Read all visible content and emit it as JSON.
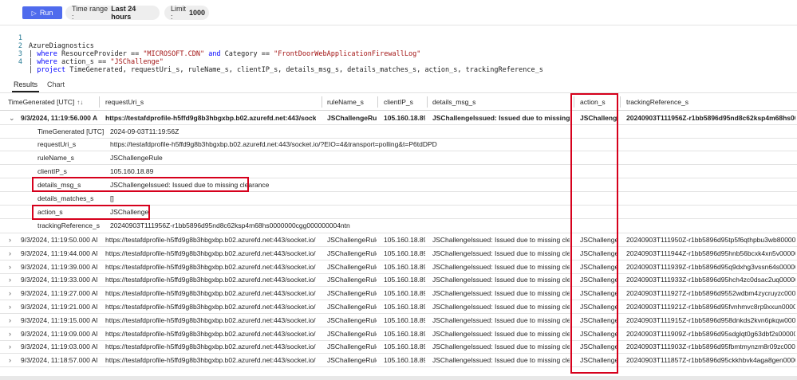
{
  "toolbar": {
    "run_label": "Run",
    "time_range_label": "Time range :",
    "time_range_value": "Last 24 hours",
    "limit_label": "Limit :",
    "limit_value": "1000"
  },
  "editor": {
    "lines": [
      {
        "num": "1",
        "text": "AzureDiagnostics"
      },
      {
        "num": "2",
        "pipe": "| ",
        "kw1": "where",
        "t1": " ResourceProvider == ",
        "s1": "\"MICROSOFT.CDN\"",
        "kw2": " and",
        "t2": " Category == ",
        "s2": "\"FrontDoorWebApplicationFirewallLog\""
      },
      {
        "num": "3",
        "pipe": "| ",
        "kw1": "where",
        "t1": " action_s == ",
        "s1": "\"JSChallenge\""
      },
      {
        "num": "4",
        "pipe": "| ",
        "kw1": "project",
        "t1": " TimeGenerated, requestUri_s, ruleName_s, clientIP_s, details_msg_s, details_matches_s, action_s, trackingReference_s"
      }
    ],
    "more": "···"
  },
  "tabs": [
    "Results",
    "Chart"
  ],
  "columns": [
    "TimeGenerated [UTC]",
    "requestUri_s",
    "ruleName_s",
    "clientIP_s",
    "details_msg_s",
    "action_s",
    "trackingReference_s"
  ],
  "expanded_row": {
    "time": "9/3/2024, 11:19:56.000 AM",
    "uri": "https://testafdprofile-h5ffd9g8b3hbgxbp.b02.azurefd.net:443/socket.io/?EI...",
    "rule": "JSChallengeRule",
    "ip": "105.160.18.89",
    "msg": "JSChallengeIssued: Issued due to missing cleara...",
    "action": "JSChallenge",
    "tracking": "20240903T111956Z-r1bb5896d95nd8c62ksp4m68hs000000..."
  },
  "details": [
    {
      "key": "TimeGenerated [UTC]",
      "value": "2024-09-03T11:19:56Z"
    },
    {
      "key": "requestUri_s",
      "value": "https://testafdprofile-h5ffd9g8b3hbgxbp.b02.azurefd.net:443/socket.io/?EIO=4&transport=polling&t=P6tdDPD"
    },
    {
      "key": "ruleName_s",
      "value": "JSChallengeRule"
    },
    {
      "key": "clientIP_s",
      "value": "105.160.18.89"
    },
    {
      "key": "details_msg_s",
      "value": "JSChallengeIssued: Issued due to missing clearance"
    },
    {
      "key": "details_matches_s",
      "value": "[]"
    },
    {
      "key": "action_s",
      "value": "JSChallenge"
    },
    {
      "key": "trackingReference_s",
      "value": "20240903T111956Z-r1bb5896d95nd8c62ksp4m68hs0000000cgg000000004ntn"
    }
  ],
  "rows": [
    {
      "time": "9/3/2024, 11:19:50.000 AM",
      "uri": "https://testafdprofile-h5ffd9g8b3hbgxbp.b02.azurefd.net:443/socket.io/?EIO=...",
      "rule": "JSChallengeRule",
      "ip": "105.160.18.89",
      "msg": "JSChallengeIssued: Issued due to missing clearance",
      "action": "JSChallenge",
      "tracking": "20240903T111950Z-r1bb5896d95tp5f6qthpbu3wb8000000..."
    },
    {
      "time": "9/3/2024, 11:19:44.000 AM",
      "uri": "https://testafdprofile-h5ffd9g8b3hbgxbp.b02.azurefd.net:443/socket.io/?EIO=...",
      "rule": "JSChallengeRule",
      "ip": "105.160.18.89",
      "msg": "JSChallengeIssued: Issued due to missing clearance",
      "action": "JSChallenge",
      "tracking": "20240903T111944Z-r1bb5896d95hnb56bcxk4xn5v000000..."
    },
    {
      "time": "9/3/2024, 11:19:39.000 AM",
      "uri": "https://testafdprofile-h5ffd9g8b3hbgxbp.b02.azurefd.net:443/socket.io/?EIO=...",
      "rule": "JSChallengeRule",
      "ip": "105.160.18.89",
      "msg": "JSChallengeIssued: Issued due to missing clearance",
      "action": "JSChallenge",
      "tracking": "20240903T111939Z-r1bb5896d95q9dxhg3vssn64s000000..."
    },
    {
      "time": "9/3/2024, 11:19:33.000 AM",
      "uri": "https://testafdprofile-h5ffd9g8b3hbgxbp.b02.azurefd.net:443/socket.io/?EIO=...",
      "rule": "JSChallengeRule",
      "ip": "105.160.18.89",
      "msg": "JSChallengeIssued: Issued due to missing clearance",
      "action": "JSChallenge",
      "tracking": "20240903T111933Z-r1bb5896d95hch4zc0dsac2uq000000..."
    },
    {
      "time": "9/3/2024, 11:19:27.000 AM",
      "uri": "https://testafdprofile-h5ffd9g8b3hbgxbp.b02.azurefd.net:443/socket.io/?EIO=...",
      "rule": "JSChallengeRule",
      "ip": "105.160.18.89",
      "msg": "JSChallengeIssued: Issued due to missing clearance",
      "action": "JSChallenge",
      "tracking": "20240903T111927Z-r1bb5896d9552wdbm4zycruyzc000000..."
    },
    {
      "time": "9/3/2024, 11:19:21.000 AM",
      "uri": "https://testafdprofile-h5ffd9g8b3hbgxbp.b02.azurefd.net:443/socket.io/?EIO=...",
      "rule": "JSChallengeRule",
      "ip": "105.160.18.89",
      "msg": "JSChallengeIssued: Issued due to missing clearance",
      "action": "JSChallenge",
      "tracking": "20240903T111921Z-r1bb5896d95fvnhmvc8rp9xxun000000..."
    },
    {
      "time": "9/3/2024, 11:19:15.000 AM",
      "uri": "https://testafdprofile-h5ffd9g8b3hbgxbp.b02.azurefd.net:443/socket.io/?EIO=...",
      "rule": "JSChallengeRule",
      "ip": "105.160.18.89",
      "msg": "JSChallengeIssued: Issued due to missing clearance",
      "action": "JSChallenge",
      "tracking": "20240903T111915Z-r1bb5896d958dnkds2kvn6pkqw000000..."
    },
    {
      "time": "9/3/2024, 11:19:09.000 AM",
      "uri": "https://testafdprofile-h5ffd9g8b3hbgxbp.b02.azurefd.net:443/socket.io/?EIO=...",
      "rule": "JSChallengeRule",
      "ip": "105.160.18.89",
      "msg": "JSChallengeIssued: Issued due to missing clearance",
      "action": "JSChallenge",
      "tracking": "20240903T111909Z-r1bb5896d95sdglqt0g63dbf2s000000..."
    },
    {
      "time": "9/3/2024, 11:19:03.000 AM",
      "uri": "https://testafdprofile-h5ffd9g8b3hbgxbp.b02.azurefd.net:443/socket.io/?EIO=...",
      "rule": "JSChallengeRule",
      "ip": "105.160.18.89",
      "msg": "JSChallengeIssued: Issued due to missing clearance",
      "action": "JSChallenge",
      "tracking": "20240903T111903Z-r1bb5896d95fbmtmynzm8r09zc000000..."
    },
    {
      "time": "9/3/2024, 11:18:57.000 AM",
      "uri": "https://testafdprofile-h5ffd9g8b3hbgxbp.b02.azurefd.net:443/socket.io/?EIO=...",
      "rule": "JSChallengeRule",
      "ip": "105.160.18.89",
      "msg": "JSChallengeIssued: Issued due to missing clearance",
      "action": "JSChallenge",
      "tracking": "20240903T111857Z-r1bb5896d95ckkhbvk4aga8gen000000..."
    }
  ],
  "colors": {
    "accent": "#4f6bed",
    "highlight": "#d6001c"
  },
  "icons": {
    "run": "play-icon",
    "sort": "sort-icon",
    "expand": "chevron-right-icon",
    "collapse": "chevron-down-icon"
  }
}
